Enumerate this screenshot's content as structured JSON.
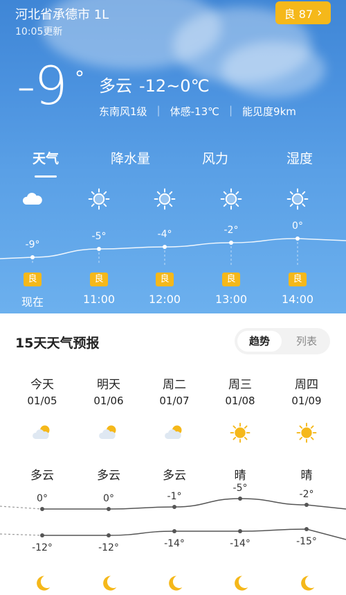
{
  "header": {
    "location": "河北省承德市 1L",
    "updated": "10:05更新",
    "aqi_label": "良 87",
    "aqi_chevron": "›"
  },
  "current": {
    "temp": "-9",
    "degree": "°",
    "condition": "多云",
    "range": "-12~0℃",
    "wind": "东南风1级",
    "feels_like": "体感-13℃",
    "visibility": "能见度9km",
    "separator": "|"
  },
  "tabs": [
    {
      "label": "天气",
      "active": true
    },
    {
      "label": "降水量",
      "active": false
    },
    {
      "label": "风力",
      "active": false
    },
    {
      "label": "湿度",
      "active": false
    }
  ],
  "hourly": [
    {
      "time": "现在",
      "temp": -9,
      "temp_label": "-9°",
      "icon": "cloudy-icon",
      "aqi": "良"
    },
    {
      "time": "11:00",
      "temp": -5,
      "temp_label": "-5°",
      "icon": "sunny-icon",
      "aqi": "良"
    },
    {
      "time": "12:00",
      "temp": -4,
      "temp_label": "-4°",
      "icon": "sunny-icon",
      "aqi": "良"
    },
    {
      "time": "13:00",
      "temp": -2,
      "temp_label": "-2°",
      "icon": "sunny-icon",
      "aqi": "良"
    },
    {
      "time": "14:00",
      "temp": 0,
      "temp_label": "0°",
      "icon": "sunny-icon",
      "aqi": "良"
    }
  ],
  "forecast": {
    "title": "15天天气预报",
    "toggle_trend": "趋势",
    "toggle_list": "列表",
    "days": [
      {
        "name": "今天",
        "date": "01/05",
        "condition": "多云",
        "icon": "partly-cloudy-icon",
        "high": 0,
        "high_label": "0°",
        "low": -12,
        "low_label": "-12°",
        "night_icon": "moon-icon"
      },
      {
        "name": "明天",
        "date": "01/06",
        "condition": "多云",
        "icon": "partly-cloudy-icon",
        "high": 0,
        "high_label": "0°",
        "low": -12,
        "low_label": "-12°",
        "night_icon": "moon-icon"
      },
      {
        "name": "周二",
        "date": "01/07",
        "condition": "多云",
        "icon": "partly-cloudy-icon",
        "high": -1,
        "high_label": "-1°",
        "low": -14,
        "low_label": "-14°",
        "night_icon": "moon-icon"
      },
      {
        "name": "周三",
        "date": "01/08",
        "condition": "晴",
        "icon": "sun-icon",
        "high": -5,
        "high_label": "-5°",
        "low": -14,
        "low_label": "-14°",
        "night_icon": "moon-icon"
      },
      {
        "name": "周四",
        "date": "01/09",
        "condition": "晴",
        "icon": "sun-icon",
        "high": -2,
        "high_label": "-2°",
        "low": -15,
        "low_label": "-15°",
        "night_icon": "moon-icon"
      }
    ]
  },
  "colors": {
    "badge": "#f5b81a",
    "sky_top": "#3f86d6",
    "sky_bottom": "#6cb0ee",
    "sun": "#f5b81a",
    "line": "#555555"
  }
}
